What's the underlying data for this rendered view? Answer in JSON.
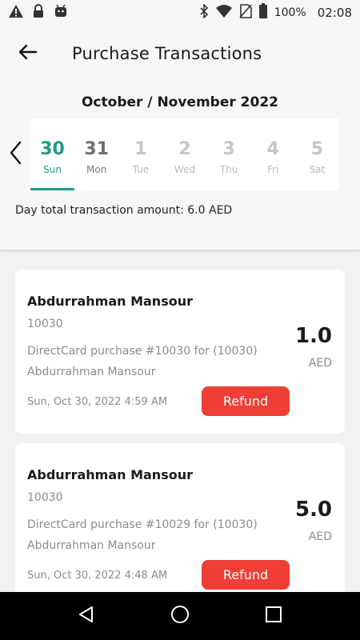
{
  "status_bar": {
    "battery": "100%",
    "time": "02:08",
    "icons": [
      "warning-icon",
      "lock-icon",
      "android-icon",
      "bluetooth-icon",
      "wifi-icon",
      "no-sim-icon",
      "battery-icon"
    ]
  },
  "header": {
    "title": "Purchase Transactions",
    "back_icon": "arrow-left-icon"
  },
  "calendar": {
    "month_title": "October  / November 2022",
    "prev_icon": "chevron-left-icon",
    "days": [
      {
        "num": "30",
        "name": "Sun"
      },
      {
        "num": "31",
        "name": "Mon"
      },
      {
        "num": "1",
        "name": "Tue"
      },
      {
        "num": "2",
        "name": "Wed"
      },
      {
        "num": "3",
        "name": "Thu"
      },
      {
        "num": "4",
        "name": "Fri"
      },
      {
        "num": "5",
        "name": "Sat"
      }
    ],
    "selected_day": "30",
    "day_total": "Day total transaction amount: 6.0 AED"
  },
  "transactions": [
    {
      "name": "Abdurrahman Mansour",
      "id": "10030",
      "description": "DirectCard purchase #10030 for (10030) Abdurrahman Mansour",
      "date": "Sun, Oct 30, 2022 4:59 AM",
      "amount": "1.0",
      "currency": "AED",
      "refund_label": "Refund"
    },
    {
      "name": "Abdurrahman Mansour",
      "id": "10030",
      "description": "DirectCard purchase #10029 for (10030) Abdurrahman Mansour",
      "date": "Sun, Oct 30, 2022 4:48 AM",
      "amount": "5.0",
      "currency": "AED",
      "refund_label": "Refund"
    }
  ],
  "nav_bar": {
    "icons": [
      "back-triangle-icon",
      "home-circle-icon",
      "recents-square-icon"
    ]
  },
  "colors": {
    "accent": "#1e9c86",
    "refund": "#ef3e35"
  }
}
